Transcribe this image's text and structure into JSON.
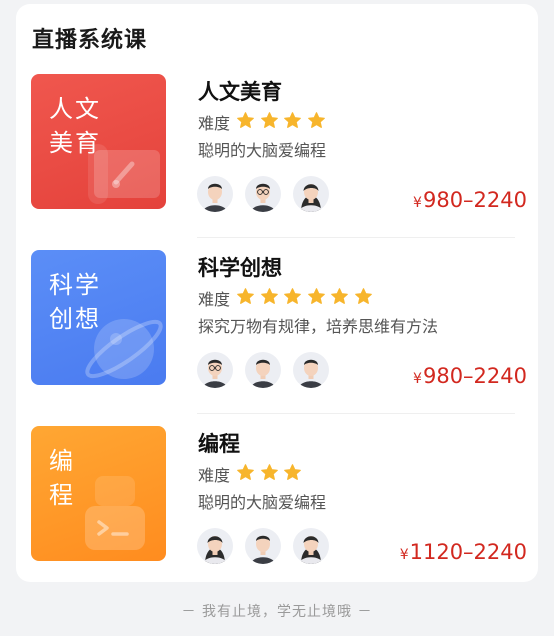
{
  "section": {
    "title": "直播系统课"
  },
  "courses": [
    {
      "thumb_line1": "人文",
      "thumb_line2": "美育",
      "title": "人文美育",
      "difficulty_label": "难度",
      "difficulty_stars": 4,
      "description": "聪明的大脑爱编程",
      "currency": "¥",
      "price": "980–2240",
      "teachers": [
        "teacher-male",
        "teacher-male-glasses",
        "teacher-female"
      ]
    },
    {
      "thumb_line1": "科学",
      "thumb_line2": "创想",
      "title": "科学创想",
      "difficulty_label": "难度",
      "difficulty_stars": 6,
      "description": "探究万物有规律，培养思维有方法",
      "currency": "¥",
      "price": "980–2240",
      "teachers": [
        "teacher-male-glasses",
        "teacher-male",
        "teacher-male"
      ]
    },
    {
      "thumb_line1": "编",
      "thumb_line2": "程",
      "title": "编程",
      "difficulty_label": "难度",
      "difficulty_stars": 3,
      "description": "聪明的大脑爱编程",
      "currency": "¥",
      "price": "1120–2240",
      "teachers": [
        "teacher-female",
        "teacher-male",
        "teacher-female"
      ]
    }
  ],
  "footer": {
    "note": "－ 我有止境，学无止境哦 －"
  },
  "colors": {
    "price": "#d2281f",
    "star": "#f7b52c",
    "thumb_red": "#e8473f",
    "thumb_blue": "#4f80f3",
    "thumb_orange": "#ff9526"
  }
}
